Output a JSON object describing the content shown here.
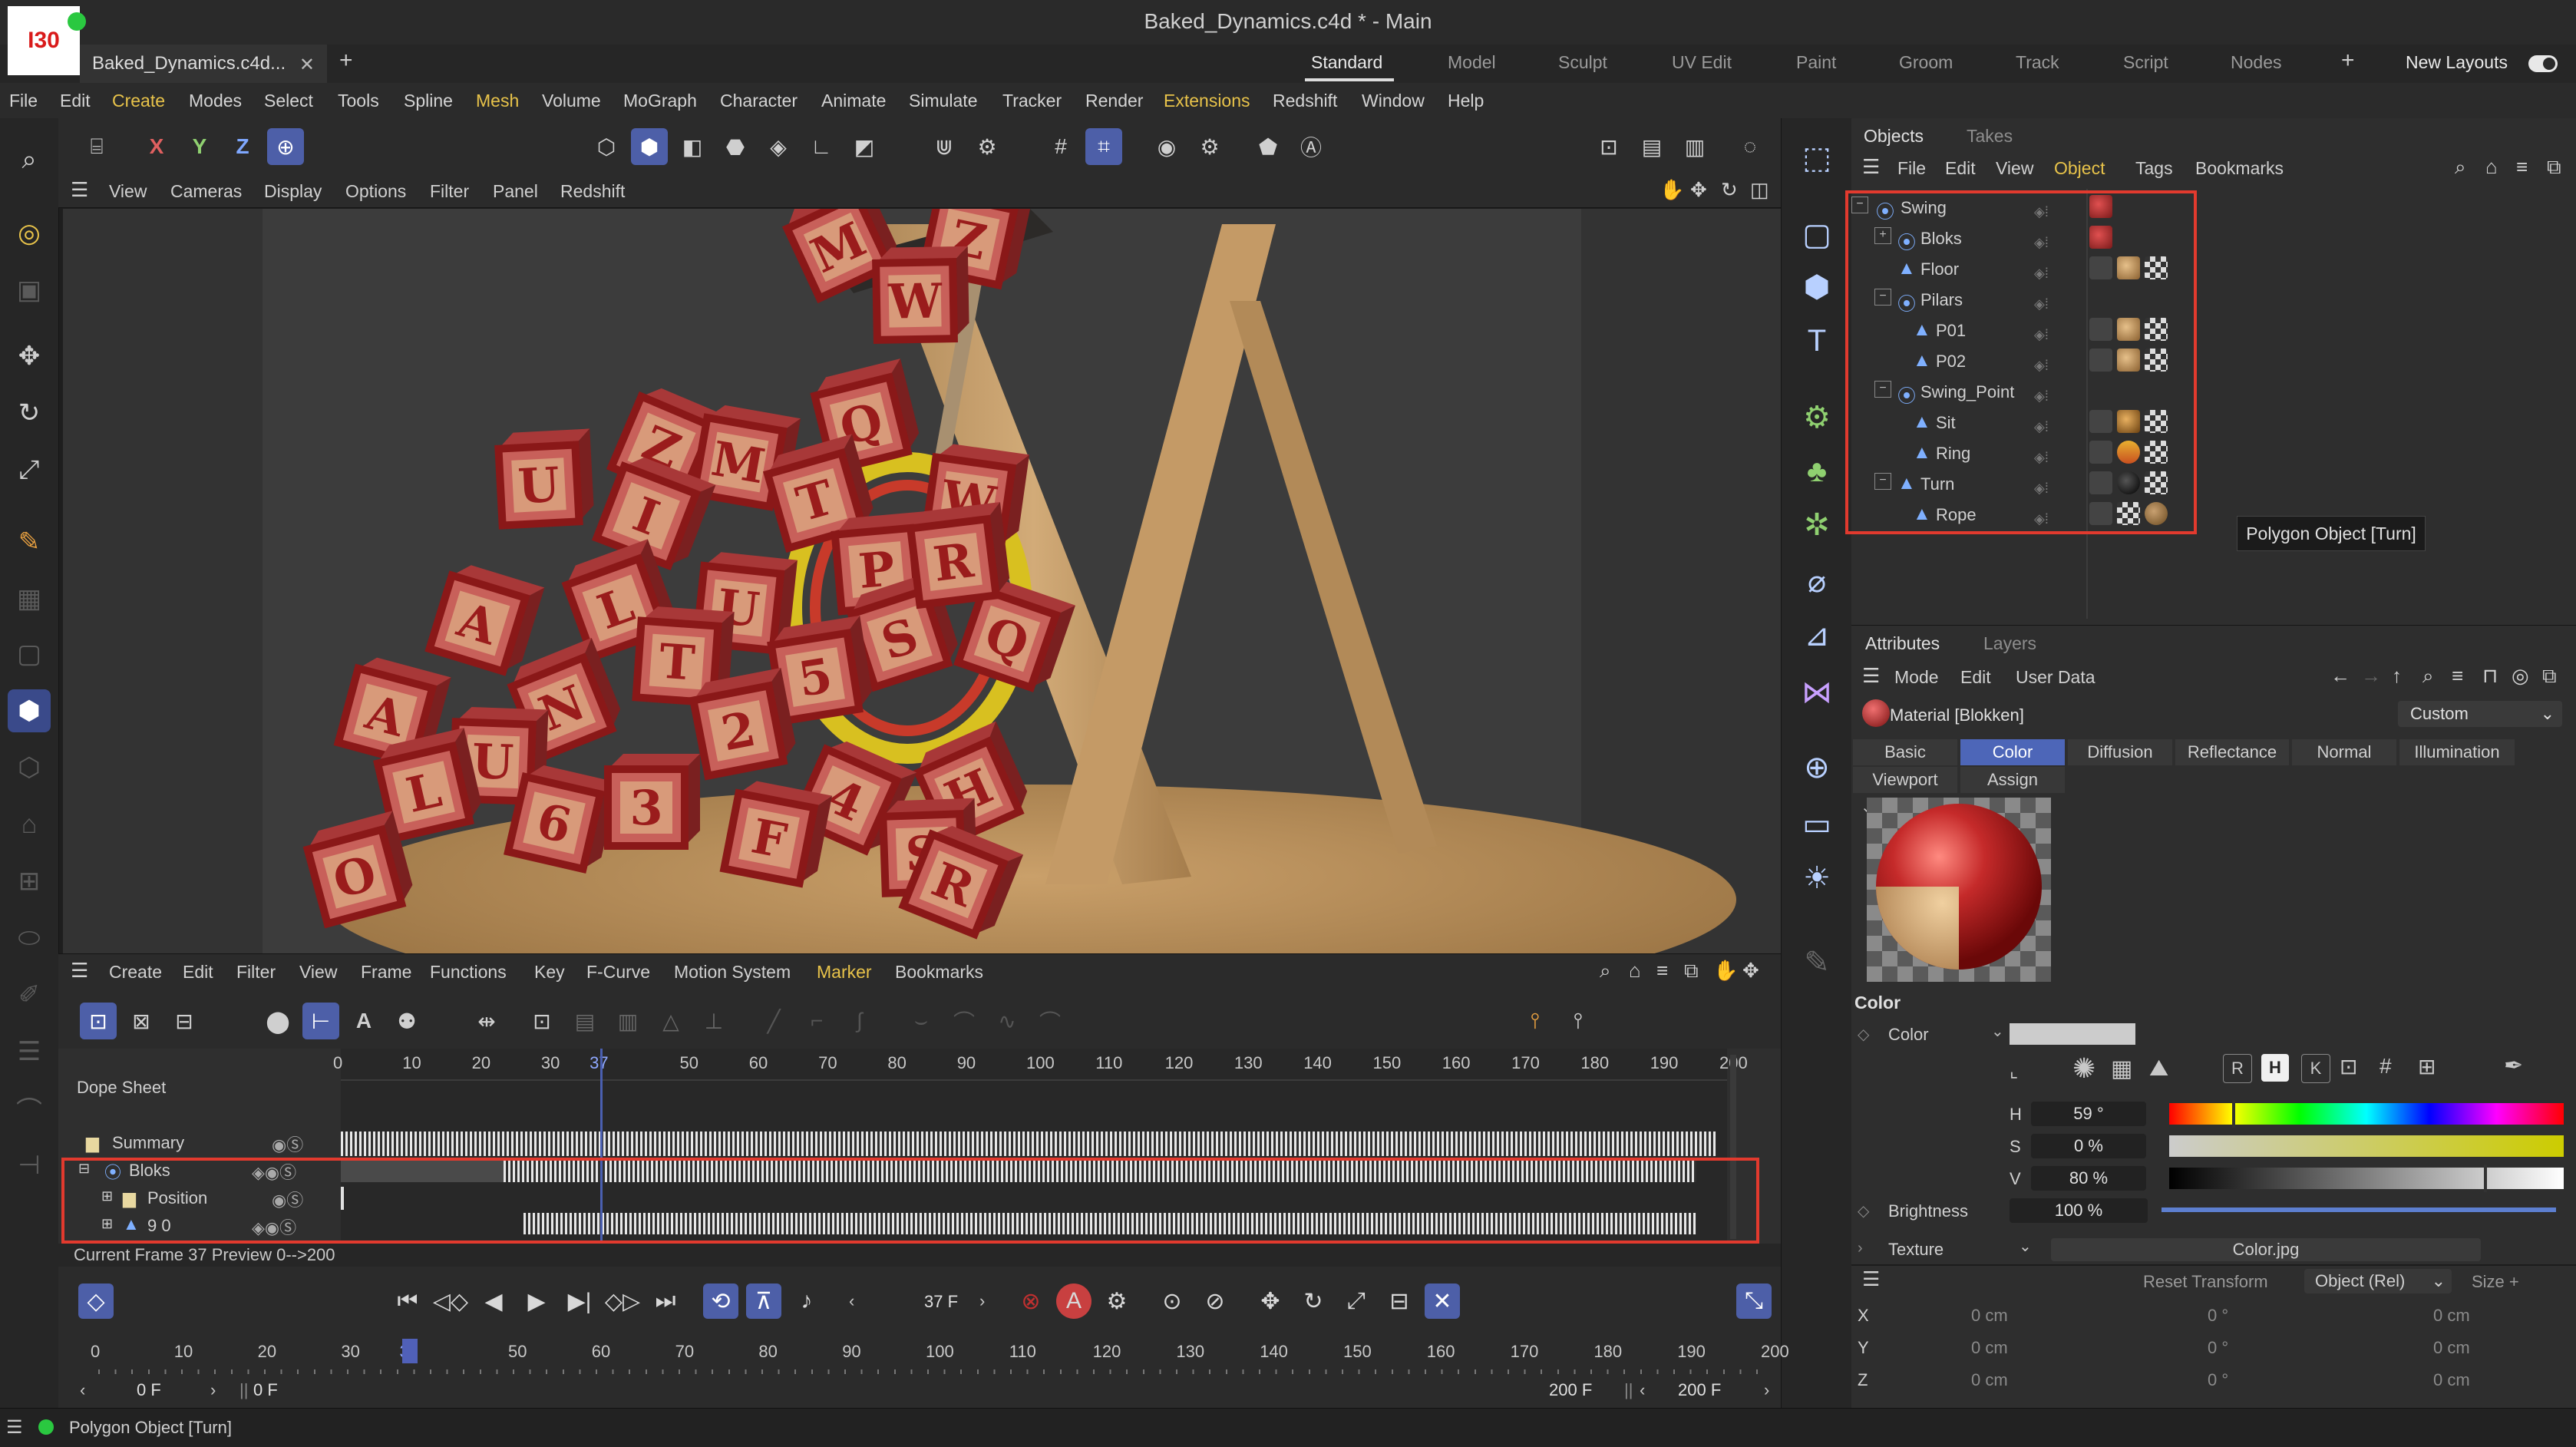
{
  "window": {
    "title": "Baked_Dynamics.c4d * - Main",
    "logo_text": "I30"
  },
  "tabs": {
    "doc_tab": "Baked_Dynamics.c4d...",
    "layouts": [
      "Standard",
      "Model",
      "Sculpt",
      "UV Edit",
      "Paint",
      "Groom",
      "Track",
      "Script",
      "Nodes"
    ],
    "active_layout": "Standard",
    "new_layouts": "New Layouts"
  },
  "menu": [
    "File",
    "Edit",
    "Create",
    "Modes",
    "Select",
    "Tools",
    "Spline",
    "Mesh",
    "Volume",
    "MoGraph",
    "Character",
    "Animate",
    "Simulate",
    "Tracker",
    "Render",
    "Extensions",
    "Redshift",
    "Window",
    "Help"
  ],
  "highlighted_menus": [
    "Create",
    "Mesh",
    "Extensions"
  ],
  "toolbar": {
    "axis_x": "X",
    "axis_y": "Y",
    "axis_z": "Z"
  },
  "viewport_menu": [
    "View",
    "Cameras",
    "Display",
    "Options",
    "Filter",
    "Panel",
    "Redshift"
  ],
  "viewport_scene": {
    "block_letters": [
      "M",
      "Z",
      "W",
      "Q",
      "Z",
      "M",
      "U",
      "T",
      "I",
      "W",
      "P",
      "S",
      "Q",
      "U",
      "R",
      "L",
      "A",
      "T",
      "5",
      "N",
      "A",
      "U",
      "2",
      "H",
      "6",
      "3",
      "L",
      "4",
      "F",
      "S",
      "O",
      "R"
    ]
  },
  "objects_panel": {
    "tabs": [
      "Objects",
      "Takes"
    ],
    "menu": [
      "File",
      "Edit",
      "View",
      "Object",
      "Tags",
      "Bookmarks"
    ],
    "highlighted_menu": "Object",
    "items": [
      {
        "label": "Swing",
        "depth": 0
      },
      {
        "label": "Bloks",
        "depth": 1
      },
      {
        "label": "Floor",
        "depth": 1
      },
      {
        "label": "Pilars",
        "depth": 1
      },
      {
        "label": "P01",
        "depth": 2
      },
      {
        "label": "P02",
        "depth": 2
      },
      {
        "label": "Swing_Point",
        "depth": 1
      },
      {
        "label": "Sit",
        "depth": 2
      },
      {
        "label": "Ring",
        "depth": 2
      },
      {
        "label": "Turn",
        "depth": 1
      },
      {
        "label": "Rope",
        "depth": 2
      }
    ],
    "tooltip": "Polygon Object [Turn]"
  },
  "attributes_panel": {
    "tabs": [
      "Attributes",
      "Layers"
    ],
    "menu": [
      "Mode",
      "Edit",
      "User Data"
    ],
    "material_title": "Material [Blokken]",
    "preset": "Custom",
    "subtabs_row1": [
      "Basic",
      "Color",
      "Diffusion",
      "Reflectance",
      "Normal",
      "Illumination"
    ],
    "subtabs_row2": [
      "Viewport",
      "Assign"
    ],
    "active_subtab": "Color",
    "section_title": "Color",
    "color_label": "Color",
    "color_mode_buttons": [
      "R",
      "H",
      "K"
    ],
    "hsv": [
      {
        "label": "H",
        "value": "59 °"
      },
      {
        "label": "S",
        "value": "0 %"
      },
      {
        "label": "V",
        "value": "80 %"
      }
    ],
    "brightness_label": "Brightness",
    "brightness_value": "100 %",
    "texture_label": "Texture",
    "texture_file": "Color.jpg"
  },
  "coords": {
    "reset": "Reset Transform",
    "mode": "Object (Rel)",
    "size": "Size +",
    "rows": [
      {
        "axis": "X",
        "pos": "0 cm",
        "rot": "0 °",
        "size": "0 cm"
      },
      {
        "axis": "Y",
        "pos": "0 cm",
        "rot": "0 °",
        "size": "0 cm"
      },
      {
        "axis": "Z",
        "pos": "0 cm",
        "rot": "0 °",
        "size": "0 cm"
      }
    ]
  },
  "timeline": {
    "menu": [
      "Create",
      "Edit",
      "Filter",
      "View",
      "Frame",
      "Functions",
      "Key",
      "F-Curve",
      "Motion System",
      "Marker",
      "Bookmarks"
    ],
    "highlighted_menu": "Marker",
    "title": "Dope Sheet",
    "ruler": [
      "0",
      "10",
      "20",
      "30",
      "37",
      "50",
      "60",
      "70",
      "80",
      "90",
      "100",
      "110",
      "120",
      "130",
      "140",
      "150",
      "160",
      "170",
      "180",
      "190",
      "200"
    ],
    "tracks": [
      {
        "label": "Summary"
      },
      {
        "label": "Bloks"
      },
      {
        "label": "Position"
      },
      {
        "label": "9 0"
      }
    ],
    "status": "Current Frame  37  Preview  0-->200"
  },
  "transport": {
    "current_frame": "37 F",
    "start_field": "0 F",
    "preview_start": "0 F",
    "end_field": "200 F",
    "preview_end": "200 F",
    "ruler": [
      "0",
      "10",
      "20",
      "30",
      "37",
      "50",
      "60",
      "70",
      "80",
      "90",
      "100",
      "110",
      "120",
      "130",
      "140",
      "150",
      "160",
      "170",
      "180",
      "190",
      "200"
    ]
  },
  "statusbar": {
    "text": "Polygon Object [Turn]"
  }
}
